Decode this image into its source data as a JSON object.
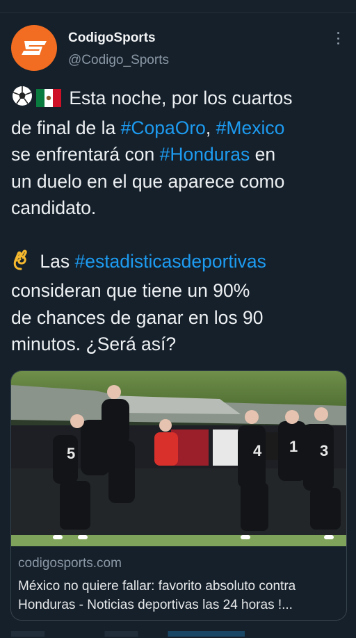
{
  "account": {
    "name": "CodigoSports",
    "handle": "@Codigo_Sports"
  },
  "tweet": {
    "icons": [
      "soccer-ball-icon",
      "mexico-flag-icon",
      "ok-hand-icon"
    ],
    "p1": [
      {
        "t": "Esta noche, por los cuartos",
        "tag": false
      },
      {
        "t": "de final de la ",
        "tag": false
      },
      {
        "t": "#CopaOro",
        "tag": true
      },
      {
        "t": ", ",
        "tag": false
      },
      {
        "t": "#Mexico",
        "tag": true
      },
      {
        "t": "se enfrentará con ",
        "tag": false
      },
      {
        "t": "#Honduras",
        "tag": true
      },
      {
        "t": " en",
        "tag": false
      },
      {
        "t": "un duelo en el que aparece como",
        "tag": false
      },
      {
        "t": "candidato.",
        "tag": false
      }
    ],
    "p2": [
      {
        "t": "Las ",
        "tag": false
      },
      {
        "t": "#estadisticasdeportivas",
        "tag": true
      },
      {
        "t": "consideran que tiene un 90%",
        "tag": false
      },
      {
        "t": "de chances de ganar en los 90",
        "tag": false
      },
      {
        "t": "minutos. ¿Será así?",
        "tag": false
      }
    ]
  },
  "card": {
    "domain": "codigosports.com",
    "title_line1": "México no quiere fallar: favorito absoluto contra",
    "title_line2": "Honduras - Noticias deportivas las 24 horas !...",
    "jersey_numbers": [
      "5",
      "4",
      "1",
      "3"
    ]
  },
  "colors": {
    "background": "#15202b",
    "link": "#1d9bf0",
    "avatar": "#f26d21",
    "secondary_text": "#8b98a5"
  }
}
